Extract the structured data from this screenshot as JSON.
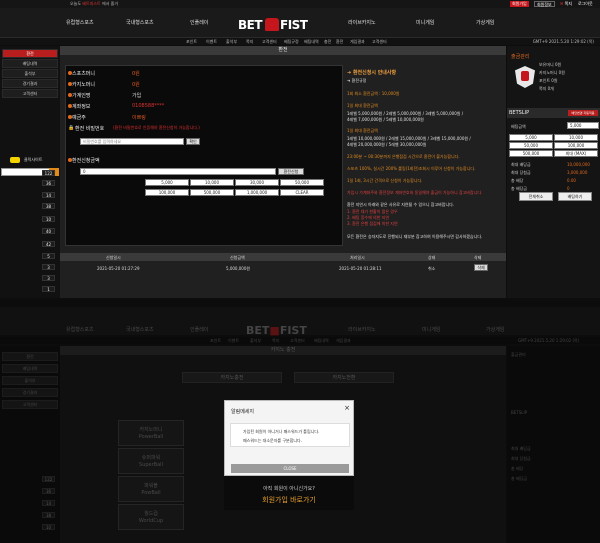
{
  "topbar": {
    "notice_prefix": "오늘도",
    "notice_highlight": "베트피스트",
    "notice_suffix": "에서 즐거",
    "signup": "회원가입",
    "login": "회원정보",
    "msg": "쪽지",
    "logout": "로그아웃"
  },
  "nav": {
    "items": [
      "유럽형스포츠",
      "국내형스포츠",
      "인플레이",
      "라이브카지노",
      "미니게임",
      "가상게임"
    ],
    "logo_left": "BET",
    "logo_right": "FIST"
  },
  "subnav": {
    "items": [
      "포인트",
      "이벤트",
      "출석부",
      "쪽지",
      "고객센터",
      "베팅규정",
      "배팅내역",
      "충전",
      "환전",
      "게임결과",
      "고객센터"
    ],
    "clock": "GMT+9 2021.5.20 1:29:02 (목)"
  },
  "left": {
    "menu": [
      "환전",
      "배팅내역",
      "출석부",
      "경기결과",
      "고객센터"
    ],
    "kakao": "클릭사이트",
    "search_icon": "search-icon",
    "badges": [
      "122",
      "36",
      "14",
      "38",
      "10",
      "40",
      "42",
      "5",
      "3",
      "3",
      "1",
      "1"
    ]
  },
  "main": {
    "title": "환전",
    "form": {
      "sports_label": "스포츠머니",
      "sports_value": "0원",
      "casino_label": "카지노머니",
      "casino_value": "0원",
      "depositor_label": "가계인명",
      "depositor_value": "가입",
      "account_label": "계좌정보",
      "account_value": "0108588****",
      "bank_label": "예금주",
      "bank_value": "이쁘링",
      "pw_label": "환전 비밀번호",
      "pw_hint": "(환전 비밀번호로 인증해야 환전신청이 가능합니다.)",
      "pw_placeholder": "비밀번호를 입력하세요",
      "pw_btn": "확인",
      "amount_label": "환전신청금액",
      "amount_value": "0",
      "amount_btn": "환전신청",
      "amounts_row1": [
        "5,000",
        "10,000",
        "30,000",
        "50,000"
      ],
      "amounts_row2": [
        "100,000",
        "500,000",
        "1,000,000",
        "CLEAR"
      ]
    },
    "info": {
      "title": "환전신청시 안내사항",
      "sub": "환전규정",
      "l1": "1회 최소 환전금액 : 10,000원",
      "l2": "1일 최대 환전금액",
      "l3": "1레벨 5,000,000원 / 2레벨 5,000,000원 / 3레벨 5,000,000원 /",
      "l4": "4레벨 7,000,000원 / 5레벨 10,000,000원",
      "l5": "1일 최대 환전금액",
      "l6": "1레벨 10,000,000원 / 2레벨 15,000,000원 / 3레벨 15,000,000원 /",
      "l7": "4레벨 20,000,000원 / 5레벨 30,000,000원",
      "l8": "23:00분 ~ 00:30분까지 은행점검 시간으로 환전이 불가능합니다.",
      "l9": "스포츠 100%, 실시간 200% 롤링(1회전)조회시 이루어 신청이 가능합니다.",
      "l10": "1일 1회, 3시간 간격으로 신청이 가능합니다.",
      "l11": "가입시 가계좌주와 환전정보 계좌번호와 동일해야 출금이 가능하니 참고바랍니다.",
      "l12": "환전 지연시 아래와 같은 사유로 지연될 수 있으니 참고바랍니다.",
      "l13": "1. 환전 대기 현황이 많은 경우",
      "l14": "2. 배팅 증수에 의한 지연",
      "l15": "3. 환전 은행 점검에 의한 지연",
      "l16": "모든 환전은 승자지도로 진행되니 재부분 참고하여 이용해주시면 감사하겠습니다."
    },
    "history": {
      "headers": [
        "신청일시",
        "신청금액",
        "처리일시",
        "상태",
        "삭제"
      ],
      "row": [
        "2021-05-20 01:27:29",
        "5,000,000원",
        "2021-05-20 01:28:11",
        "취소",
        "삭제"
      ]
    }
  },
  "right": {
    "user": "출금관리",
    "lines": [
      "보유머니 0원",
      "카지노머니 0원",
      "포인트 0원",
      "쪽지 0개"
    ],
    "slip_title": "BETSLIP",
    "slip_btn": "배당변경 자동적용",
    "bet_amount": "배팅금액",
    "amount_value": "5,000",
    "odds": [
      "5,000",
      "10,000",
      "50,000",
      "100,000",
      "500,000",
      "최대 (MAX)"
    ],
    "rows": [
      {
        "k": "최대 배당금",
        "v": "10,000,000"
      },
      {
        "k": "최대 당첨금",
        "v": "3,000,000"
      },
      {
        "k": "총 배당",
        "v": "0.00"
      },
      {
        "k": "총 배당금",
        "v": "0"
      }
    ],
    "clear_btn": "전체취소",
    "bet_btn": "배팅하기"
  },
  "modal": {
    "title": "알림메세지",
    "line1": "가입된 회원이 아니거나 패스워드가 틀립니다.",
    "line2": "패스워드는 대소문자를 구분합니다.",
    "close": "CLOSE"
  },
  "below_modal": {
    "question": "아직 회원이 아니신가요?",
    "signup_link": "회원가입 바로가기"
  },
  "bottom": {
    "title": "카지노 충전",
    "tabs": [
      "카지노충전",
      "카지노전환"
    ],
    "cards": [
      "카지노머니\nPowerBall",
      "슈퍼파워\nSuperBall",
      "파워볼\nPowBall",
      "월드컵\nWorldCup"
    ]
  }
}
